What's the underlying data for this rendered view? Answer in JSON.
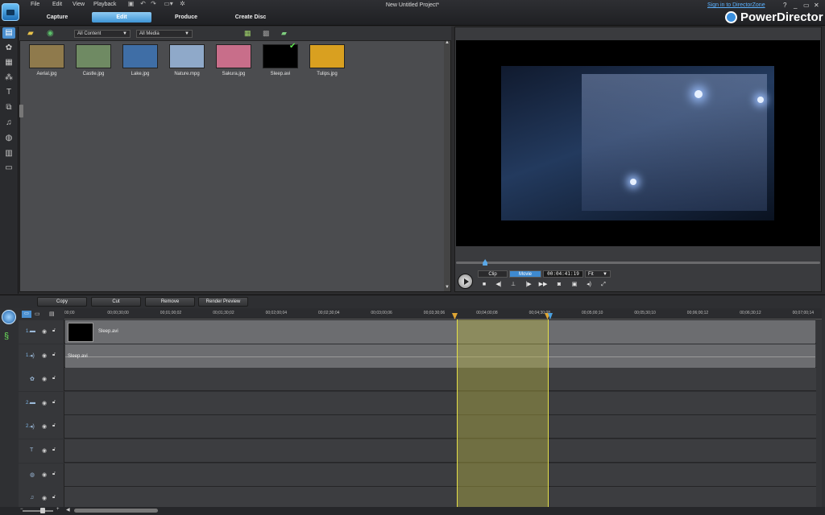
{
  "menu": [
    "File",
    "Edit",
    "View",
    "Playback"
  ],
  "project_title": "New Untitled Project*",
  "signin": "Sign in to DirectorZone",
  "window_controls": [
    "?",
    "_",
    "▭",
    "✕"
  ],
  "brand": "PowerDirector",
  "tabs": [
    "Capture",
    "Edit",
    "Produce",
    "Create Disc"
  ],
  "library": {
    "filter_content": "All Content",
    "filter_media": "All Media",
    "items": [
      {
        "name": "Aerial.jpg",
        "color": "#8f7a4c"
      },
      {
        "name": "Castle.jpg",
        "color": "#6f8a63"
      },
      {
        "name": "Lake.jpg",
        "color": "#3f6ea6"
      },
      {
        "name": "Nature.mpg",
        "color": "#8fa9c9"
      },
      {
        "name": "Sakura.jpg",
        "color": "#c86e8a"
      },
      {
        "name": "Sleep.avi",
        "color": "#000000"
      },
      {
        "name": "Tulips.jpg",
        "color": "#d9a020"
      }
    ]
  },
  "preview": {
    "clip_label": "Clip",
    "movie_label": "Movie",
    "timecode": "00:04:41:19",
    "fit": "Fit",
    "progress_fraction": 0.08
  },
  "edit_buttons": [
    "Copy",
    "Cut",
    "Remove",
    "Render Preview"
  ],
  "ruler_ticks": [
    "00;00",
    "00;00;30;00",
    "00;01;00;02",
    "00;01;30;02",
    "00;02;00;04",
    "00;02;30;04",
    "00;03;00;06",
    "00;03;30;06",
    "00;04;00;08",
    "00;04;30;08",
    "00;05;00;10",
    "00;05;30;10",
    "00;06;00;12",
    "00;06;30;12",
    "00;07;00;14"
  ],
  "tracks": [
    {
      "num": "1.",
      "icon": "video-icon",
      "clip": "Sleep.avi"
    },
    {
      "num": "1.",
      "icon": "audio-icon",
      "clip": "Sleep.avi"
    },
    {
      "num": "",
      "icon": "effect-icon",
      "clip": ""
    },
    {
      "num": "2.",
      "icon": "video-icon",
      "clip": ""
    },
    {
      "num": "2.",
      "icon": "audio-icon",
      "clip": ""
    },
    {
      "num": "",
      "icon": "title-icon",
      "clip": ""
    },
    {
      "num": "",
      "icon": "voice-icon",
      "clip": ""
    },
    {
      "num": "",
      "icon": "music-icon",
      "clip": ""
    }
  ]
}
